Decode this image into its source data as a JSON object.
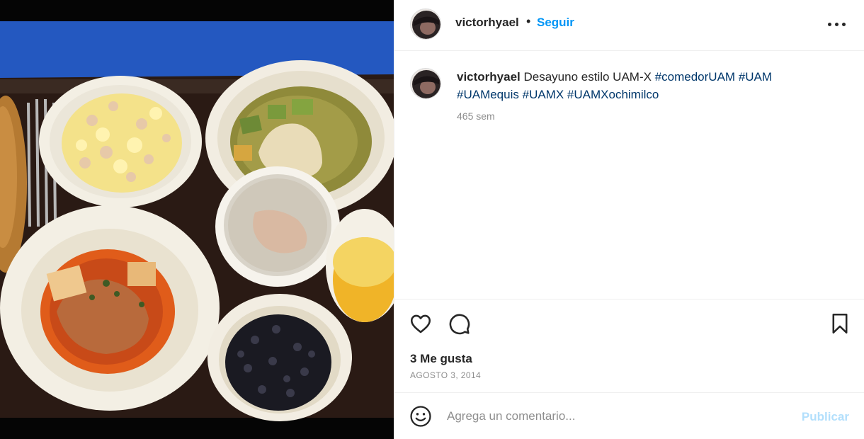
{
  "post": {
    "username": "victorhyael",
    "separator": "•",
    "follow_label": "Seguir",
    "more_icon": "more-horizontal-icon"
  },
  "caption": {
    "username": "victorhyael",
    "text": "Desayuno estilo UAM-X",
    "hashtags": [
      "#comedorUAM",
      "#UAM",
      "#UAMequis",
      "#UAMX",
      "#UAMXochimilco"
    ],
    "time": "465 sem"
  },
  "actions": {
    "like_icon": "heart-icon",
    "comment_icon": "comment-bubble-icon",
    "save_icon": "bookmark-icon",
    "likes": "3 Me gusta",
    "date": "AGOSTO 3, 2014"
  },
  "comment_box": {
    "emoji_icon": "smiley-icon",
    "placeholder": "Agrega un comentario...",
    "value": "",
    "publish_label": "Publicar"
  },
  "colors": {
    "link_blue": "#0095f6",
    "hashtag_blue": "#00376b",
    "muted_gray": "#8e8e8e",
    "publish_disabled": "#b2dffc"
  }
}
